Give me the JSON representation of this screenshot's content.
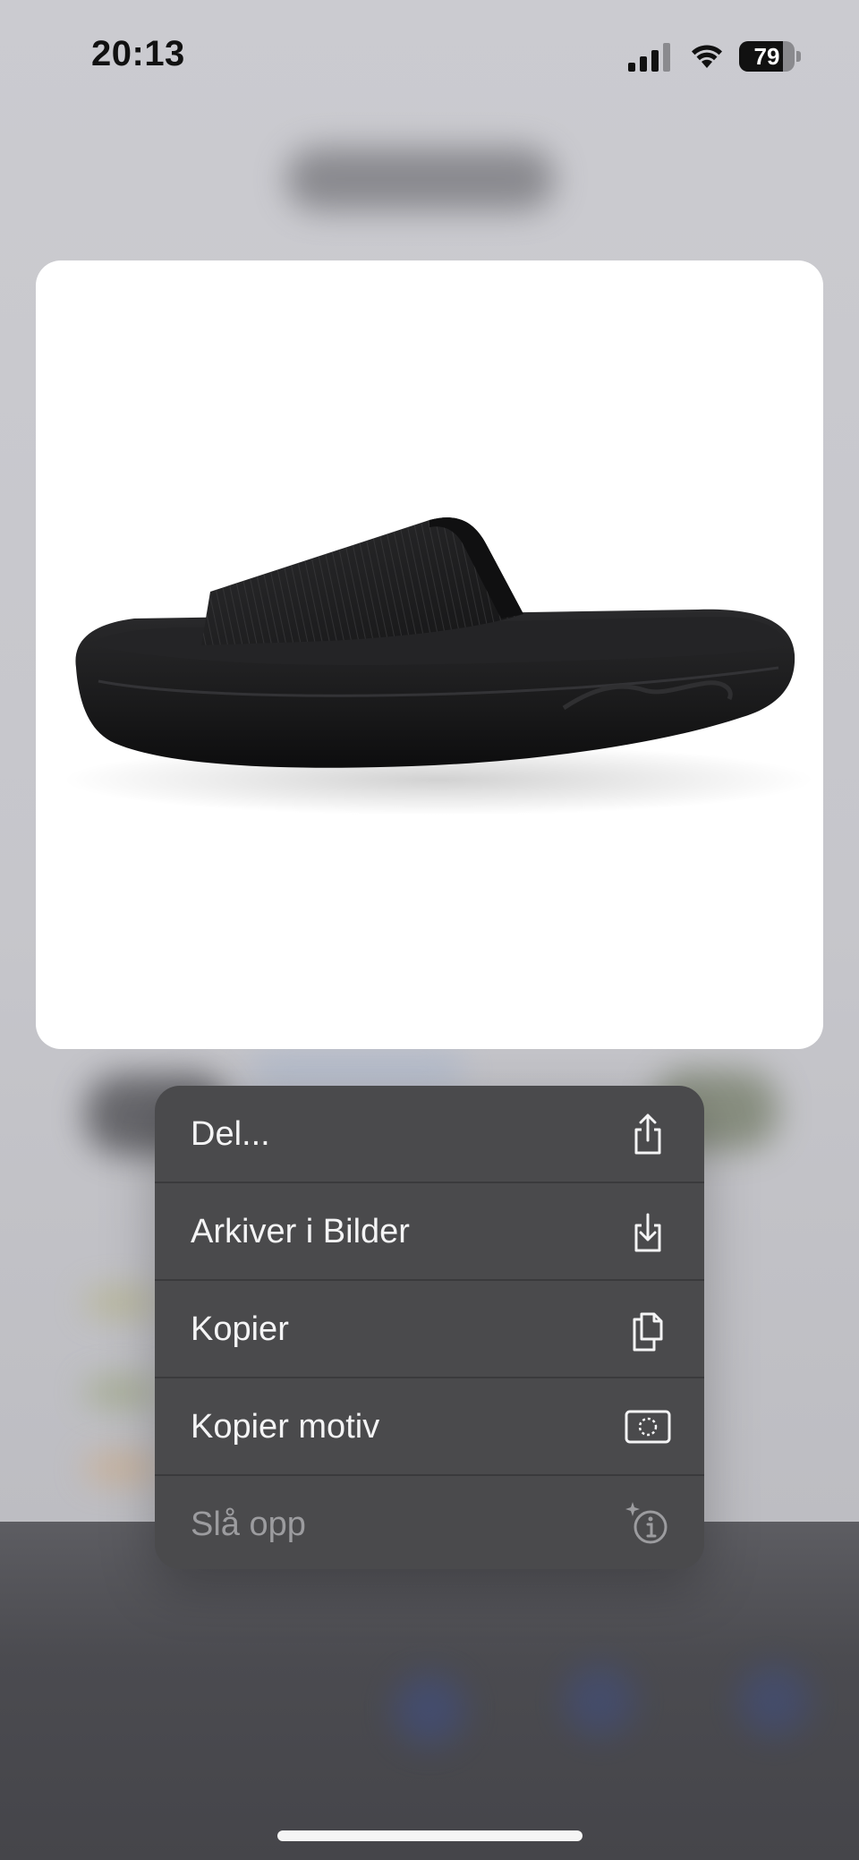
{
  "status_bar": {
    "time": "20:13",
    "battery_level": "79",
    "signal_bars": 3
  },
  "preview": {
    "image_alt": "black slide sandal product photo"
  },
  "context_menu": {
    "items": [
      {
        "label": "Del...",
        "icon": "share-icon",
        "enabled": true
      },
      {
        "label": "Arkiver i Bilder",
        "icon": "save-to-photos-icon",
        "enabled": true
      },
      {
        "label": "Kopier",
        "icon": "copy-icon",
        "enabled": true
      },
      {
        "label": "Kopier motiv",
        "icon": "copy-subject-icon",
        "enabled": true
      },
      {
        "label": "Slå opp",
        "icon": "visual-look-up-icon",
        "enabled": false
      }
    ]
  },
  "colors": {
    "menu_background": "#4a4a4c",
    "menu_text": "#f4f4f5",
    "menu_text_disabled": "#9c9c9f"
  }
}
